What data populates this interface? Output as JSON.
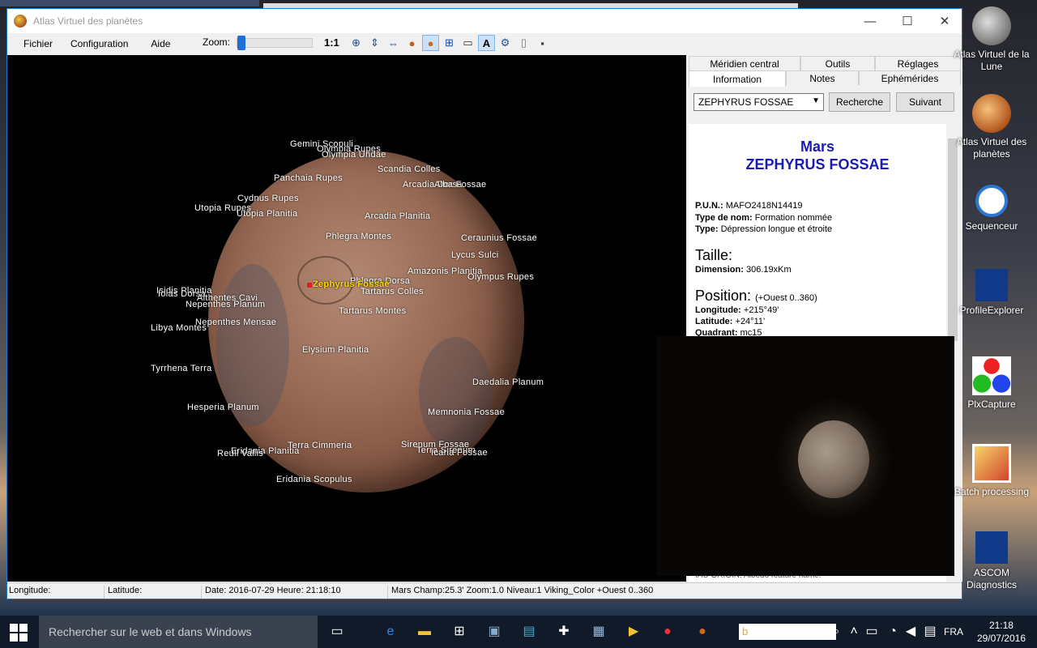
{
  "window": {
    "title": "Atlas Virtuel des planètes",
    "min": "—",
    "max": "☐",
    "close": "✕"
  },
  "menu": [
    "Fichier",
    "Configuration",
    "Aide"
  ],
  "toolbar": {
    "zoom_label": "Zoom:",
    "zoom_value": 0.02,
    "ratio_label": "1:1"
  },
  "tabs": {
    "top": [
      "Méridien central",
      "Outils",
      "Réglages"
    ],
    "bottom": [
      "Information",
      "Notes",
      "Ephémérides"
    ],
    "active": "Information"
  },
  "search": {
    "value": "ZEPHYRUS FOSSAE",
    "search_btn": "Recherche",
    "next_btn": "Suivant"
  },
  "info": {
    "planet": "Mars",
    "feature": "ZEPHYRUS FOSSAE",
    "pun_label": "P.U.N.:",
    "pun": "MAFO2418N14419",
    "type_nom_label": "Type de nom:",
    "type_nom": "Formation nommée",
    "type_label": "Type:",
    "type": "Dépression longue et étroite",
    "taille_title": "Taille:",
    "dimension_label": "Dimension:",
    "dimension": "306.19xKm",
    "position_title": "Position:",
    "position_note": "(+Ouest 0..360)",
    "longitude_label": "Longitude:",
    "longitude": "+215°49'",
    "latitude_label": "Latitude:",
    "latitude": "+24°11'",
    "quadrant_label": "Quadrant:",
    "quadrant": "mc15",
    "iau_origin": "IAU ORIGIN: Albedo feature name."
  },
  "map_labels": [
    "Gemini Scopuli",
    "Olympia Rupes",
    "Olympia Undae",
    "Scandia Colles",
    "Panchaia Rupes",
    "Arcadia Dorsa",
    "Alba Fossae",
    "Cydnus Rupes",
    "Utopia Rupes",
    "Utopia Planitia",
    "Arcadia Planitia",
    "Phlegra Montes",
    "Ceraunius Fossae",
    "Lycus Sulci",
    "Amazonis Planitia",
    "Olympus Rupes",
    "Phlegra Dorsa",
    "Zephyrus Fossae",
    "Isidis Planitia",
    "Iolas Dorsa",
    "Aithentes Cavi",
    "Tartarus Colles",
    "Nepenthes Planum",
    "Tartarus Montes",
    "Libya Montes",
    "Nepenthes Mensae",
    "Elysium Planitia",
    "Tyrrhena Terra",
    "Daedalia Planum",
    "Hesperia Planum",
    "Memnonia Fossae",
    "Eridania Planitia",
    "Reull Vallis",
    "Terra Cimmeria",
    "Sirenum Fossae",
    "Terra Sirenum",
    "Icaria Fossae",
    "Eridania Scopulus"
  ],
  "status": {
    "longitude": "Longitude:",
    "latitude": "Latitude:",
    "datetime": "Date: 2016-07-29   Heure: 21:18:10",
    "info": "Mars Champ:25.3' Zoom:1.0  Niveau:1 Viking_Color  +Ouest 0..360"
  },
  "desktop_icons": [
    {
      "label": "Atlas Virtuel de la Lune"
    },
    {
      "label": "Atlas Virtuel des planètes"
    },
    {
      "label": "Sequenceur"
    },
    {
      "label": "ProfileExplorer"
    },
    {
      "label": "PlxCapture"
    },
    {
      "label": "Batch processing"
    },
    {
      "label": "ASCOM Diagnostics"
    }
  ],
  "taskbar": {
    "search_placeholder": "Rechercher sur le web et dans Windows",
    "lang": "FRA",
    "time": "21:18",
    "date": "29/07/2016"
  }
}
